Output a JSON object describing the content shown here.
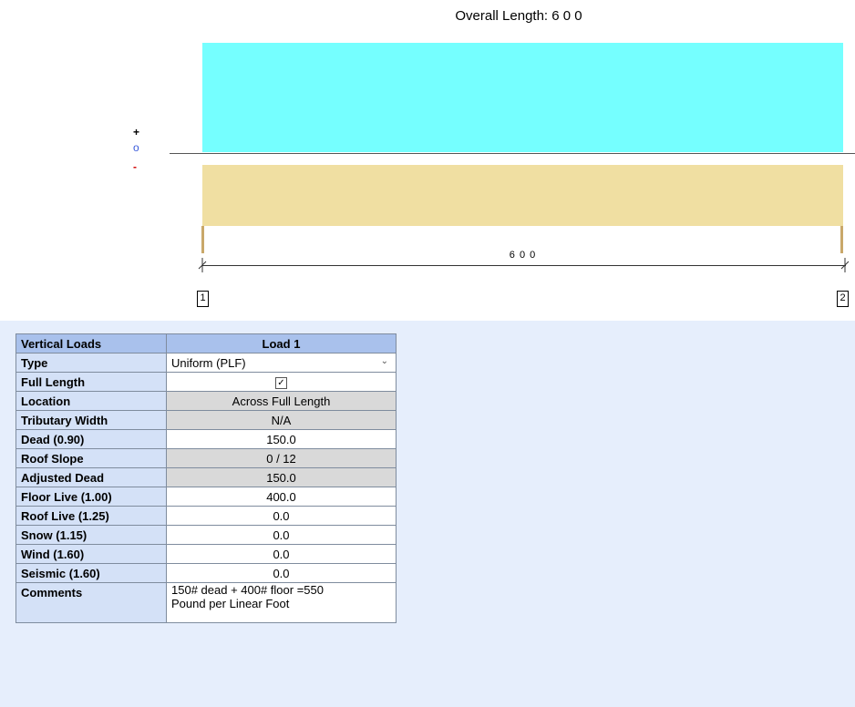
{
  "diagram": {
    "title": "Overall Length: 6 0 0",
    "sign_plus": "+",
    "sign_zero": "o",
    "sign_minus": "-",
    "span_label": "6 0 0",
    "node_1": "1",
    "node_2": "2",
    "colors": {
      "load_bar": "#75ffff",
      "member": "#f0dfa2"
    }
  },
  "table": {
    "header_label": "Vertical Loads",
    "header_value": "Load 1",
    "rows": [
      {
        "label": "Type",
        "value": "Uniform (PLF)"
      },
      {
        "label": "Full Length",
        "value": "✓"
      },
      {
        "label": "Location",
        "value": "Across Full Length"
      },
      {
        "label": "Tributary Width",
        "value": "N/A"
      },
      {
        "label": "Dead (0.90)",
        "value": "150.0"
      },
      {
        "label": "Roof Slope",
        "value": "0 / 12"
      },
      {
        "label": "Adjusted Dead",
        "value": "150.0"
      },
      {
        "label": "Floor Live (1.00)",
        "value": "400.0"
      },
      {
        "label": "Roof Live (1.25)",
        "value": "0.0"
      },
      {
        "label": "Snow (1.15)",
        "value": "0.0"
      },
      {
        "label": "Wind (1.60)",
        "value": "0.0"
      },
      {
        "label": "Seismic (1.60)",
        "value": "0.0"
      },
      {
        "label": "Comments",
        "value_line1": "150# dead + 400# floor =550",
        "value_line2": "Pound per Linear Foot"
      }
    ]
  }
}
